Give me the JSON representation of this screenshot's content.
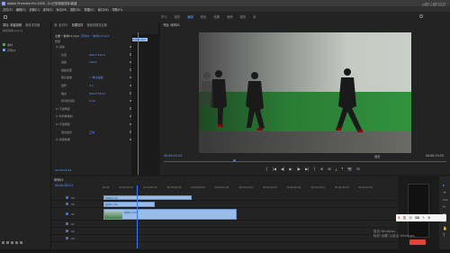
{
  "app": {
    "title": "Adobe Premiere Pro 2020 - D:\\已剪辑素材库\\新建",
    "watermark": "虎课网"
  },
  "menu": [
    "文件(F)",
    "编辑(E)",
    "剪辑(C)",
    "序列(S)",
    "标记(M)",
    "图形(G)",
    "视图(V)",
    "窗口(W)",
    "帮助(H)"
  ],
  "workspace_tabs": [
    "学习",
    "组件",
    "编辑",
    "颜色",
    "效果",
    "音频",
    "图形",
    "库"
  ],
  "workspace_active": 2,
  "project_panel": {
    "tabs": [
      "项目: 新建剪辑",
      "媒体浏览器"
    ],
    "file": "新建剪辑.prproj",
    "items": [
      {
        "label": "素材",
        "color": "#3fae5b"
      },
      {
        "label": "序列01",
        "color": "#5aa0ff"
      }
    ]
  },
  "effect_controls": {
    "tabs": [
      "源: 素材01",
      "效果控件",
      "音频剪辑混合器"
    ],
    "source_clip": "主要 * 素材01.mp4",
    "sequence": "序列01 * 素材01.mp4",
    "section": "视频",
    "rows": [
      {
        "label": "fx 运动",
        "value": ""
      },
      {
        "label": "位置",
        "value": "960.0   540.0"
      },
      {
        "label": "缩放",
        "value": "100.0"
      },
      {
        "label": "缩放宽度",
        "value": ""
      },
      {
        "label": "等比缩放",
        "value": "✓ 等比缩放"
      },
      {
        "label": "旋转",
        "value": "0.0"
      },
      {
        "label": "锚点",
        "value": "960.0   540.0"
      },
      {
        "label": "防闪烁滤镜",
        "value": "0.00"
      },
      {
        "label": "fx 不透明度",
        "value": ""
      },
      {
        "label": "fx 时间重映射",
        "value": ""
      },
      {
        "label": "fx 不透明度",
        "value": ""
      },
      {
        "label": "混合模式",
        "value": "正常"
      },
      {
        "label": "fx 音频效果",
        "value": ""
      }
    ],
    "mini_clip": "素材01.mp4",
    "timecode": "00:00:05:24"
  },
  "program_monitor": {
    "tab": "节目: 序列01",
    "timecode": "00:00:05:24",
    "fit": "适合",
    "full": "完整",
    "duration": "00:00:19:25",
    "transport": [
      "{",
      "|◀",
      "◀|",
      "▶",
      "|▶",
      "▶|",
      "}",
      "⊕",
      "⊞",
      "⤓",
      "⤒",
      "📷",
      "⊟"
    ]
  },
  "timeline": {
    "tab": "序列01",
    "timecode": "00:00:05:24",
    "ruler": [
      "00:00",
      "00:00:02:00",
      "00:00:04:00",
      "00:00:06:00",
      "00:00:08:00",
      "00:00:10:00",
      "00:00:12:00",
      "00:00:14:00",
      "00:00:16:00",
      "00:00:18:00",
      "00:00:20:00",
      "00:00:22:00"
    ],
    "tracks": [
      {
        "name": "V3",
        "clip": "素材03.mp4"
      },
      {
        "name": "V2",
        "clip": "素材02.mp4"
      },
      {
        "name": "V1",
        "clip": "素材01.mp4"
      },
      {
        "name": "A1",
        "clip": ""
      },
      {
        "name": "A2",
        "clip": ""
      },
      {
        "name": "A3",
        "clip": ""
      }
    ]
  },
  "ime": {
    "label": "英",
    "items": [
      "☺",
      "⌨",
      "✎",
      "⚙"
    ]
  },
  "windows_activation": {
    "line1": "激活 Windows",
    "line2": "转到\"设置\"以激活 Windows。"
  }
}
